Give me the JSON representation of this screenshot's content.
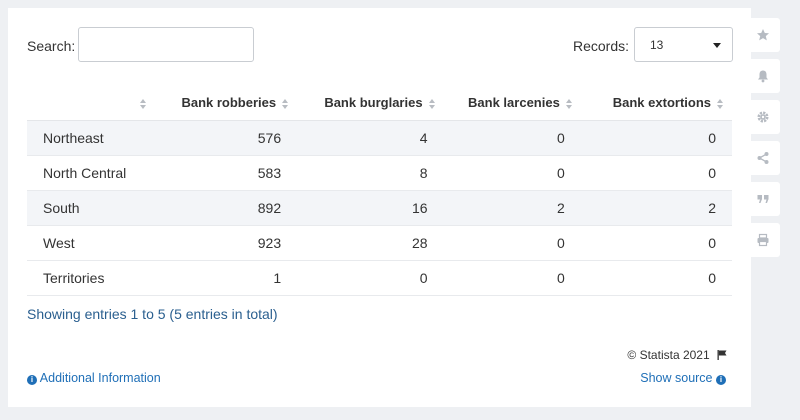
{
  "search": {
    "label": "Search:",
    "value": ""
  },
  "records": {
    "label": "Records:",
    "value": "13"
  },
  "table": {
    "headers": [
      "",
      "Bank robberies",
      "Bank burglaries",
      "Bank larcenies",
      "Bank extortions"
    ],
    "rows": [
      [
        "Northeast",
        "576",
        "4",
        "0",
        "0"
      ],
      [
        "North Central",
        "583",
        "8",
        "0",
        "0"
      ],
      [
        "South",
        "892",
        "16",
        "2",
        "2"
      ],
      [
        "West",
        "923",
        "28",
        "0",
        "0"
      ],
      [
        "Territories",
        "1",
        "0",
        "0",
        "0"
      ]
    ]
  },
  "footer": {
    "showing": "Showing entries 1 to 5 (5 entries in total)",
    "copyright": "© Statista 2021",
    "additional_info": "Additional Information",
    "show_source": "Show source"
  },
  "sidebar": {
    "icons": [
      "star-icon",
      "bell-icon",
      "gear-icon",
      "share-icon",
      "quote-icon",
      "print-icon"
    ]
  },
  "colors": {
    "link": "#1f6fb7",
    "row_stripe": "#f3f5f8",
    "background": "#eef0f3"
  }
}
